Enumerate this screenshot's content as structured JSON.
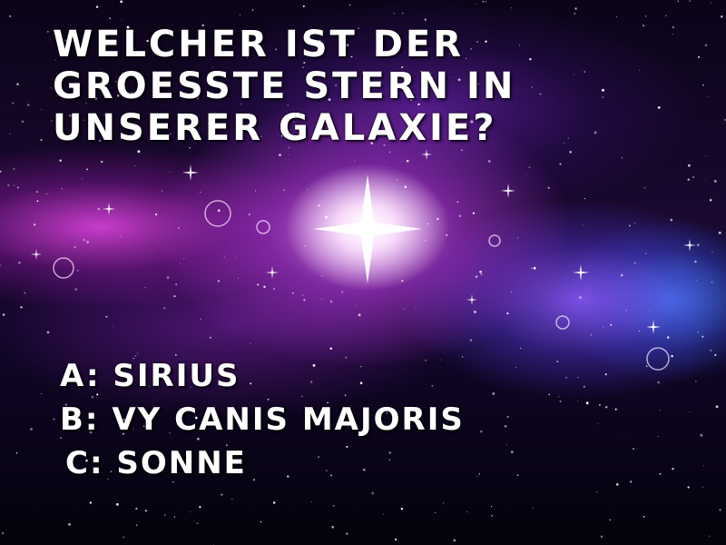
{
  "question": {
    "lines": [
      "Welcher ist der",
      "groesste Stern in",
      "unserer Galaxie?"
    ]
  },
  "answers": [
    {
      "label": "A: Sirius"
    },
    {
      "label": "B: VY Canis Majoris"
    },
    {
      "label": "C: Sonne"
    }
  ],
  "colors": {
    "text": "#ffffff",
    "nebula_magenta": "#d040e0",
    "nebula_blue": "#3c96ff",
    "space": "#05020c"
  }
}
